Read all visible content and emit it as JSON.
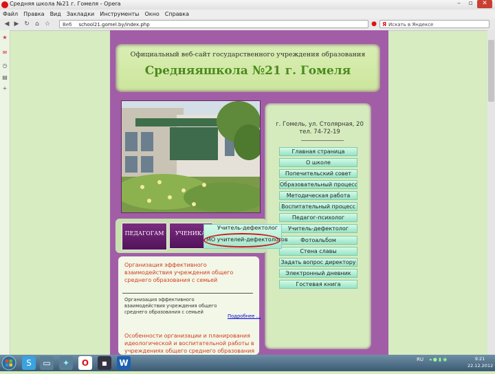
{
  "window": {
    "title": "Средняя школа №21 г. Гомеля - Opera"
  },
  "menu": [
    "Файл",
    "Правка",
    "Вид",
    "Закладки",
    "Инструменты",
    "Окно",
    "Справка"
  ],
  "address": {
    "tag": "Веб",
    "url": "school21.gomel.by/index.php"
  },
  "search": {
    "placeholder": "Искать в Яндексе",
    "engine_mark": "Я"
  },
  "header": {
    "line1": "Официальный веб-сайт государственного учреждения образования",
    "line2": "Средняяшкола №21 г. Гомеля"
  },
  "address_block": {
    "line1": "г. Гомель, ул. Столярная, 20",
    "line2": "тел. 74-72-19"
  },
  "nav": [
    "Главная страница",
    "О школе",
    "Попечительский совет",
    "Образовательный процесс",
    "Методическая работа",
    "Воспитательный процесс",
    "Педагог-психолог",
    "Учитель-дефектолог",
    "Фотоальбом",
    "Стена славы",
    "Задать вопрос директору",
    "Электронный дневник",
    "Гостевая книга"
  ],
  "tabs": {
    "teachers": "ПЕДАГОГАМ",
    "students": "УЧЕНИКАМ"
  },
  "dropdown": {
    "item1": "Учитель-дефектолог",
    "item2": "МО учителей-дефектологов"
  },
  "articles": [
    {
      "title": "Организация эффективного взаимодействия учреждения общего среднего образования с семьей",
      "summary": "Организация эффективного взаимодействия учреждения общего среднего образования с семьей",
      "more": "Подробнее ..."
    },
    {
      "title": "Особенности организации и планирования идеологической и воспитательной работы в учреждениях общего среднего образования в"
    }
  ],
  "taskbar": {
    "lang": "RU",
    "time": "9:21",
    "date": "22.12.2012"
  }
}
